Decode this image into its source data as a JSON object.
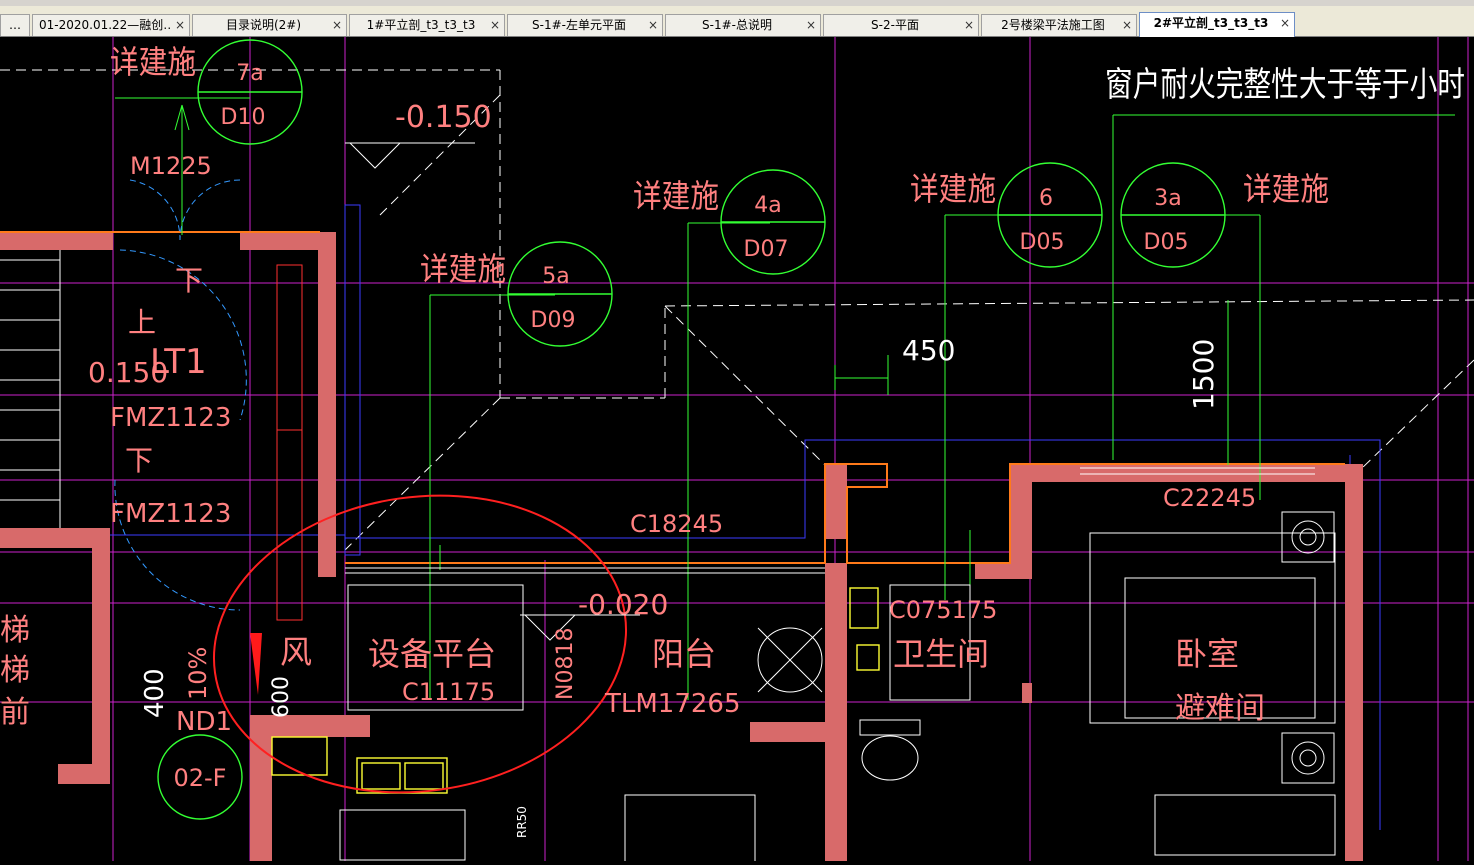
{
  "tabs": [
    {
      "label": "01-2020.01.22—融创…",
      "active": false
    },
    {
      "label": "目录说明(2#)",
      "active": false
    },
    {
      "label": "1#平立剖_t3_t3_t3",
      "active": false
    },
    {
      "label": "S-1#-左单元平面",
      "active": false
    },
    {
      "label": "S-1#-总说明",
      "active": false
    },
    {
      "label": "S-2-平面",
      "active": false
    },
    {
      "label": "2号楼梁平法施工图",
      "active": false
    },
    {
      "label": "2#平立剖_t3_t3_t3",
      "active": true
    }
  ],
  "tab_first_fragment": "…",
  "tab_close": "×",
  "colors": {
    "wall": "#d86a6a",
    "text_red": "#ff8080",
    "green": "#33ff33",
    "white": "#ffffff",
    "magenta": "#cc22cc",
    "yellow": "#ffff33",
    "cyan": "#22e0e0",
    "annotation_circle": "#ff2020"
  },
  "drawing": {
    "note_top_right": "窗户耐火完整性大于等于小时",
    "elevation_top": "-0.150",
    "elevation_balcony": "-0.020",
    "elevation_stair": "0.150",
    "detail_ref_label": "详建施",
    "detail_refs": [
      {
        "num": "7a",
        "sheet": "D10"
      },
      {
        "num": "5a",
        "sheet": "D09"
      },
      {
        "num": "4a",
        "sheet": "D07"
      },
      {
        "num": "6",
        "sheet": "D05"
      },
      {
        "num": "3a",
        "sheet": "D05"
      }
    ],
    "axis_label": "02-F",
    "dims": {
      "d450": "450",
      "d1500": "1500",
      "d400": "400",
      "d600": "600",
      "d10pct": "10%"
    },
    "labels": {
      "door_m1225": "M1225",
      "stair_lt1": "LT1",
      "stair_up": "上",
      "stair_down1": "下",
      "stair_down2": "下",
      "fire_door1": "FMZ1123",
      "fire_door2": "FMZ1123",
      "window_c18245": "C18245",
      "window_c22245": "C22245",
      "window_c075175": "C075175",
      "window_c11175": "C11175",
      "window_n0818": "N0818",
      "door_tlm17265": "TLM17265",
      "room_equipment": "设备平台",
      "room_balcony": "阳台",
      "room_bathroom": "卫生间",
      "room_bedroom": "卧室",
      "room_refuge": "避难间",
      "wind": "风",
      "nd_label": "ND1",
      "rr50": "RR50",
      "left_frag1": "梯",
      "left_frag2": "梯",
      "left_frag3": "前"
    }
  }
}
